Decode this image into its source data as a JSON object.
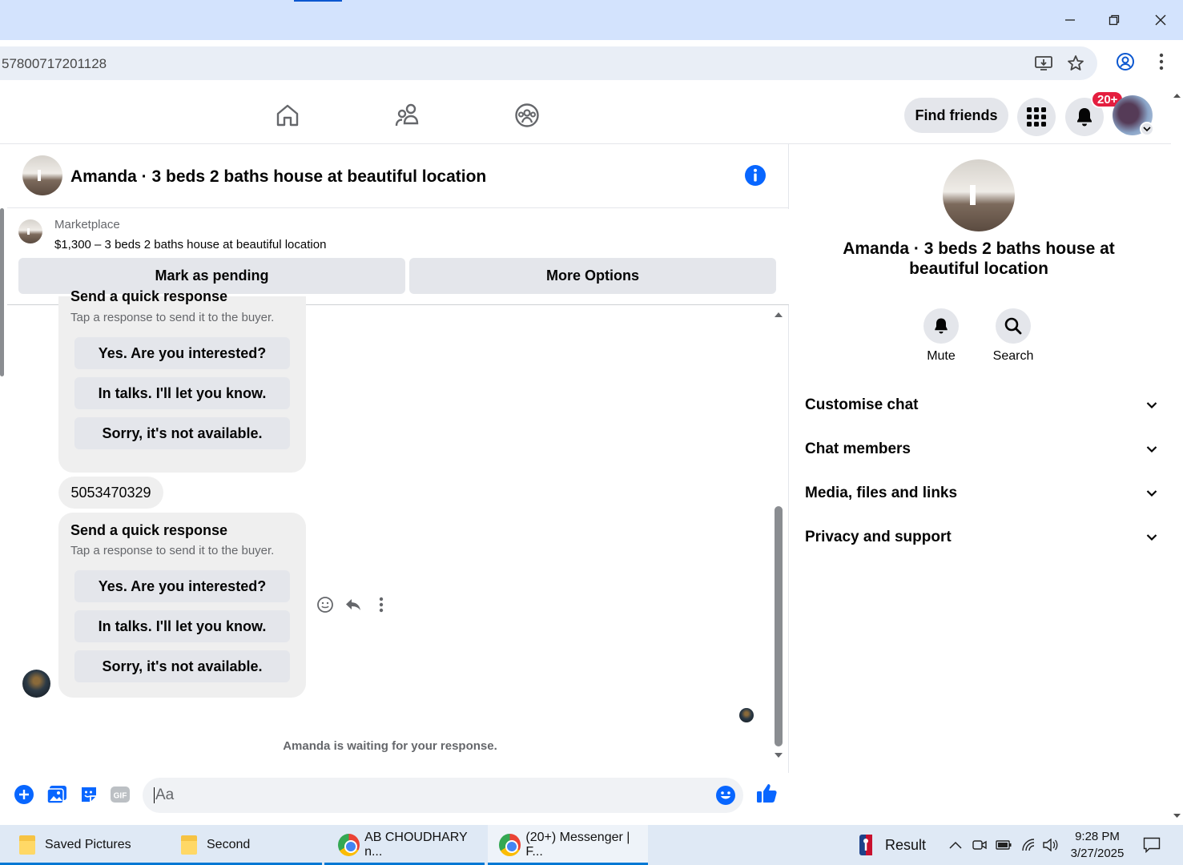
{
  "browser": {
    "url": "57800717201128",
    "window_controls": [
      "minimize-icon",
      "restore-icon",
      "close-icon"
    ],
    "omnibox_icons": [
      "install-app-icon",
      "bookmark-star-icon",
      "profile-icon",
      "chrome-menu-icon"
    ]
  },
  "fbnav": {
    "nav_icons": [
      "home-icon",
      "friends-icon",
      "groups-icon"
    ],
    "find_friends_label": "Find friends",
    "notification_badge": "20+"
  },
  "chat": {
    "title": "Amanda · 3 beds 2 baths house at beautiful location",
    "marketplace": {
      "label": "Marketplace",
      "listing": "$1,300 – 3 beds 2 baths house at beautiful location",
      "mark_pending_label": "Mark as pending",
      "more_options_label": "More Options"
    },
    "messages": [
      {
        "type": "quick_response",
        "title": "Send a quick response",
        "subtitle": "Tap a response to send it to the buyer.",
        "options": [
          "Yes. Are you interested?",
          "In talks. I'll let you know.",
          "Sorry, it's not available."
        ]
      },
      {
        "type": "text",
        "text": "5053470329"
      },
      {
        "type": "quick_response",
        "title": "Send a quick response",
        "subtitle": "Tap a response to send it to the buyer.",
        "options": [
          "Yes. Are you interested?",
          "In talks. I'll let you know.",
          "Sorry, it's not available."
        ]
      }
    ],
    "message_actions": [
      "react-icon",
      "reply-icon",
      "more-icon"
    ],
    "waiting_text": "Amanda is waiting for your response.",
    "composer": {
      "placeholder": "Aa",
      "icons": [
        "plus-icon",
        "photo-icon",
        "sticker-icon",
        "gif-icon",
        "emoji-icon",
        "like-icon"
      ]
    }
  },
  "info_panel": {
    "name": "Amanda · 3 beds 2 baths house at beautiful location",
    "actions": [
      {
        "label": "Mute",
        "icon": "bell-icon"
      },
      {
        "label": "Search",
        "icon": "search-icon"
      }
    ],
    "sections": [
      "Customise chat",
      "Chat members",
      "Media, files and links",
      "Privacy and support"
    ]
  },
  "taskbar": {
    "items": [
      {
        "label": "Saved Pictures",
        "icon": "folder-icon"
      },
      {
        "label": "Second",
        "icon": "folder-icon"
      },
      {
        "label": "AB CHOUDHARY n...",
        "icon": "chrome-icon"
      },
      {
        "label": "(20+) Messenger | F...",
        "icon": "chrome-icon"
      }
    ],
    "widget_label": "Result",
    "time": "9:28 PM",
    "date": "3/27/2025"
  },
  "colors": {
    "accent": "#0866ff",
    "titlebar": "#d3e3fd",
    "badge": "#e41e3f"
  }
}
